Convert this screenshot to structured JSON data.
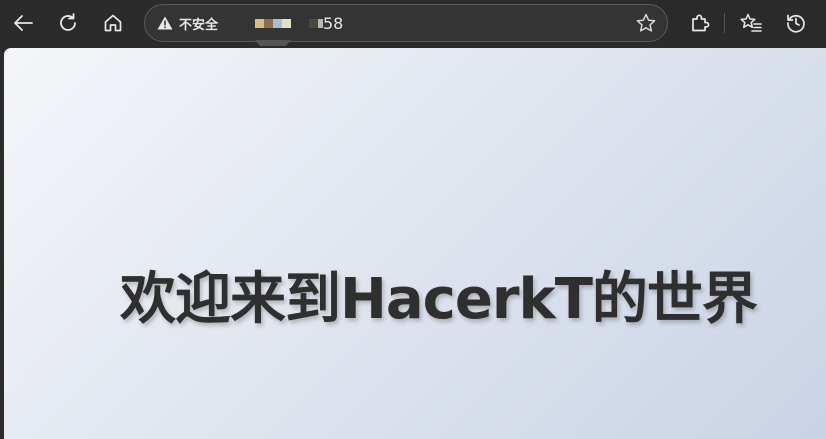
{
  "browser": {
    "security_label": "不安全",
    "url_visible_suffix": "58",
    "redacted_url_swatches": [
      "#d9b98a",
      "#8a6f4e",
      "#a9bfd0",
      "#e4e0c8"
    ],
    "redacted_url_swatches_2": [
      "#4a4a3a",
      "#b9b9b0"
    ],
    "icons": {
      "back": "back-arrow-icon",
      "refresh": "refresh-icon",
      "home": "home-icon",
      "warning": "warning-triangle-icon",
      "favorite": "star-icon",
      "extensions": "puzzle-icon",
      "favorites": "favorites-list-icon",
      "history": "history-icon"
    }
  },
  "page": {
    "heading": "欢迎来到HacerkT的世界",
    "background_gradient": [
      "#f4f6f9",
      "#e1e6ef",
      "#cad3e6"
    ],
    "heading_color": "#2f2f2f"
  }
}
